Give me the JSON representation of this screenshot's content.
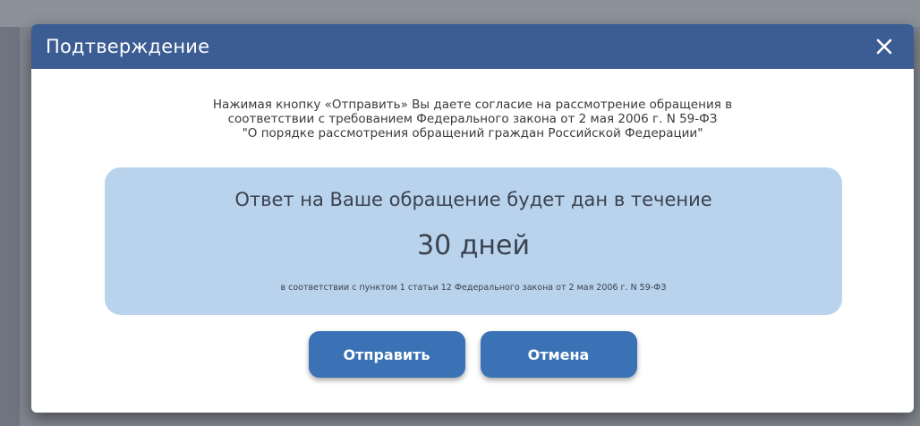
{
  "dialog": {
    "title": "Подтверждение",
    "consent_lines": [
      "Нажимая кнопку «Отправить» Вы даете согласие на рассмотрение обращения в",
      "соответствии с требованием Федерального закона от 2 мая 2006 г. N 59-ФЗ",
      "\"О порядке рассмотрения обращений граждан Российской Федерации\""
    ],
    "info": {
      "title": "Ответ на Ваше обращение будет дан в течение",
      "days": "30 дней",
      "note": "в соответствии с пунктом 1 статьи 12 Федерального закона от 2 мая 2006 г. N 59-ФЗ"
    },
    "buttons": {
      "submit_label": "Отправить",
      "cancel_label": "Отмена"
    }
  },
  "icons": {
    "close": "close-icon"
  },
  "colors": {
    "header": "#3c5d93",
    "info_box": "#b9d3ec",
    "button": "#3a72b5"
  }
}
